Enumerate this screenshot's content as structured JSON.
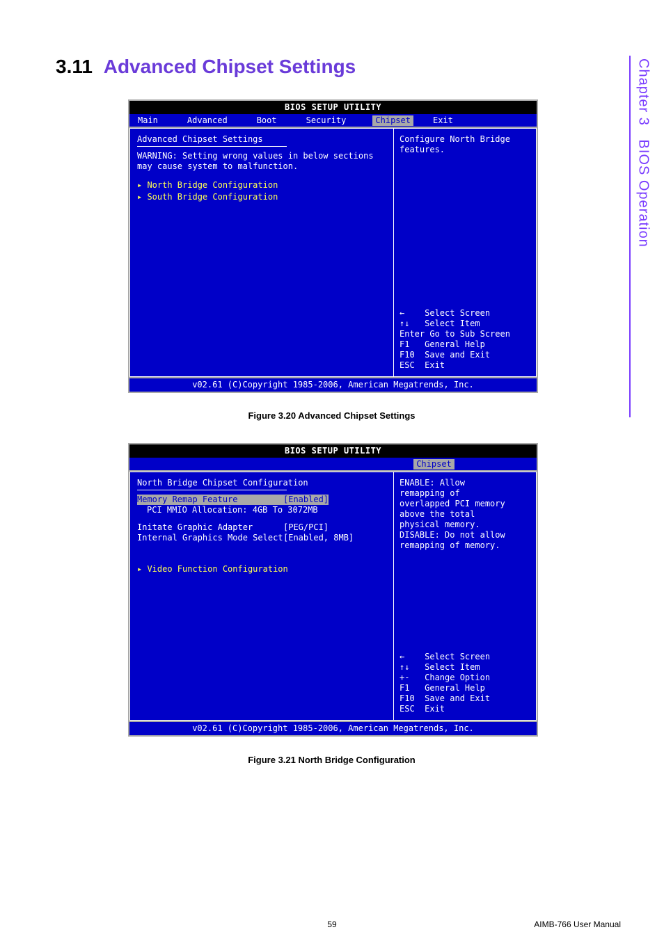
{
  "section": {
    "number": "3.11",
    "title": "Advanced Chipset Settings"
  },
  "sidebar": {
    "chapter": "Chapter 3",
    "name": "BIOS Operation"
  },
  "bios1": {
    "title": "BIOS SETUP UTILITY",
    "tabs": {
      "main": "Main",
      "advanced": "Advanced",
      "boot": "Boot",
      "security": "Security",
      "chipset": "Chipset",
      "exit": "Exit"
    },
    "left": {
      "heading": "Advanced Chipset Settings",
      "warn1": "WARNING: Setting wrong values in below sections",
      "warn2": "         may cause system to malfunction.",
      "item1": "▸ North Bridge Configuration",
      "item2": "▸ South Bridge Configuration"
    },
    "right": {
      "help": "Configure North Bridge features.",
      "keys": {
        "l1": "←    Select Screen",
        "l2": "↑↓   Select Item",
        "l3": "Enter Go to Sub Screen",
        "l4": "F1   General Help",
        "l5": "F10  Save and Exit",
        "l6": "ESC  Exit"
      }
    },
    "footer": "v02.61 (C)Copyright 1985-2006, American Megatrends, Inc."
  },
  "caption1": "Figure 3.20 Advanced Chipset Settings",
  "bios2": {
    "title": "BIOS SETUP UTILITY",
    "tab": "Chipset",
    "left": {
      "heading": "North Bridge Chipset Configuration",
      "row1k": "Memory Remap Feature",
      "row1v": "[Enabled]",
      "row2": "  PCI MMIO Allocation: 4GB To 3072MB",
      "row3k": "Initate Graphic Adapter",
      "row3v": "[PEG/PCI]",
      "row4k": "Internal Graphics Mode Select",
      "row4v": "[Enabled, 8MB]",
      "item1": "▸ Video Function Configuration"
    },
    "right": {
      "help1": "ENABLE: Allow",
      "help2": "remapping of",
      "help3": "overlapped PCI memory",
      "help4": "above the total",
      "help5": "physical memory.",
      "help6": "",
      "help7": "DISABLE: Do not allow",
      "help8": "remapping of memory.",
      "keys": {
        "l1": "←    Select Screen",
        "l2": "↑↓   Select Item",
        "l3": "+-   Change Option",
        "l4": "F1   General Help",
        "l5": "F10  Save and Exit",
        "l6": "ESC  Exit"
      }
    },
    "footer": "v02.61 (C)Copyright 1985-2006, American Megatrends, Inc."
  },
  "caption2": "Figure 3.21  North Bridge Configuration",
  "page": {
    "number": "59",
    "doc": "AIMB-766 User Manual"
  }
}
